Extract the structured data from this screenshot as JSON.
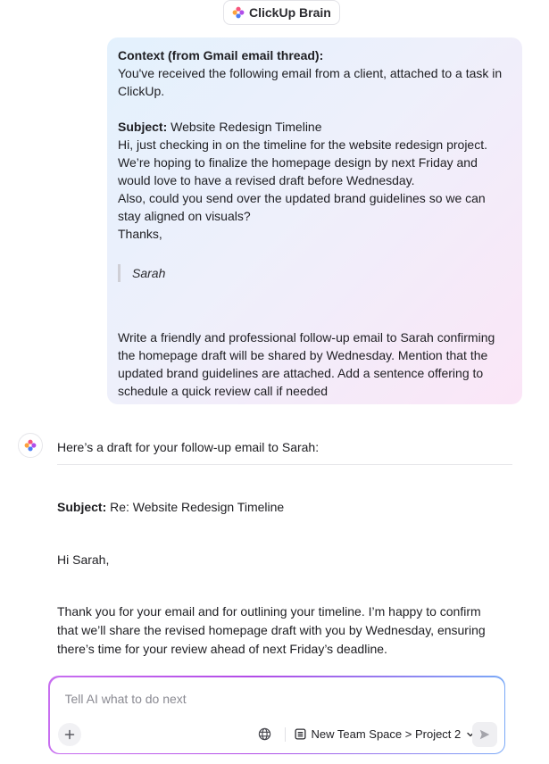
{
  "header": {
    "brand_label": "ClickUp Brain"
  },
  "user_message": {
    "context_heading": "Context (from Gmail email thread):",
    "context_text": "You've received the following email from a client, attached to a task in ClickUp.",
    "subject_label": "Subject:",
    "subject_value": " Website Redesign Timeline",
    "email_lines": [
      "Hi, just checking in on the timeline for the website redesign project.",
      "We’re hoping to finalize the homepage design by next Friday and would love to have a revised draft before Wednesday.",
      "Also, could you send over the updated brand guidelines so we can stay aligned on visuals?",
      "Thanks,"
    ],
    "signature": "Sarah",
    "instruction": "Write a friendly and professional follow-up email to Sarah confirming the homepage draft will be shared by Wednesday. Mention that the updated brand guidelines are attached. Add a sentence offering to schedule a quick review call if needed"
  },
  "assistant": {
    "intro": "Here’s a draft for your follow-up email to Sarah:",
    "subject_label": "Subject:",
    "subject_value": " Re: Website Redesign Timeline",
    "greeting": "Hi Sarah,",
    "paragraph": "Thank you for your email and for outlining your timeline. I’m happy to confirm that we’ll share the revised homepage draft with you by Wednesday, ensuring there’s time for your review ahead of next Friday’s deadline."
  },
  "composer": {
    "placeholder": "Tell AI what to do next",
    "value": "",
    "location_label": "New Team Space > Project 2"
  },
  "colors": {
    "bubble_gradient_start": "#e3f1fd",
    "bubble_gradient_end": "#fbe6f7",
    "composer_border_start": "#c86ff0",
    "composer_border_end": "#7aa9f7"
  }
}
